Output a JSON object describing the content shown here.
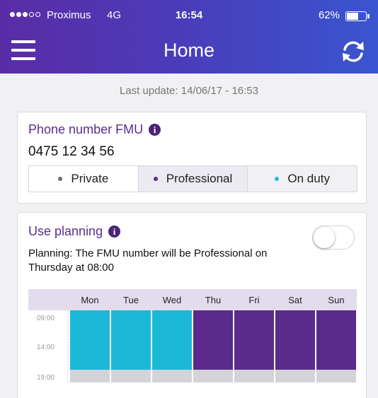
{
  "status_bar": {
    "carrier": "Proximus",
    "network": "4G",
    "time": "16:54",
    "battery_text": "62%",
    "battery_level": 0.62,
    "signal_strength": 3,
    "signal_max": 5
  },
  "header": {
    "title": "Home",
    "menu_icon": "hamburger-menu-icon",
    "refresh_icon": "refresh-icon",
    "gradient": [
      "#5a2ca6",
      "#3a55cf"
    ]
  },
  "last_update": "Last update: 14/06/17 - 16:53",
  "phone_card": {
    "title": "Phone number FMU",
    "info_icon": "info-icon",
    "info_glyph": "i",
    "number": "0475 12 34 56",
    "options": [
      {
        "label": "Private",
        "bullet_color": "#6d6d6d"
      },
      {
        "label": "Professional",
        "bullet_color": "#5a2d91"
      },
      {
        "label": "On duty",
        "bullet_color": "#2bb7d8"
      }
    ],
    "selected_option": "Professional"
  },
  "planning_card": {
    "title": "Use planning",
    "info_glyph": "i",
    "toggle_on": false,
    "note": "Planning: The FMU number will be Professional on Thursday at 08:00",
    "days": [
      "Mon",
      "Tue",
      "Wed",
      "Thu",
      "Fri",
      "Sat",
      "Sun"
    ],
    "time_labels": [
      "09:00",
      "14:00",
      "19:00"
    ],
    "schedule": [
      "On duty",
      "On duty",
      "On duty",
      "Professional",
      "Professional",
      "Professional",
      "Professional"
    ],
    "colors": {
      "On duty": "#1bb8d8",
      "Professional": "#5a2a8c",
      "header_bg": "#e3dced",
      "off_hours": "#d4d4d8",
      "axis_text": "#9a9aa0"
    }
  }
}
